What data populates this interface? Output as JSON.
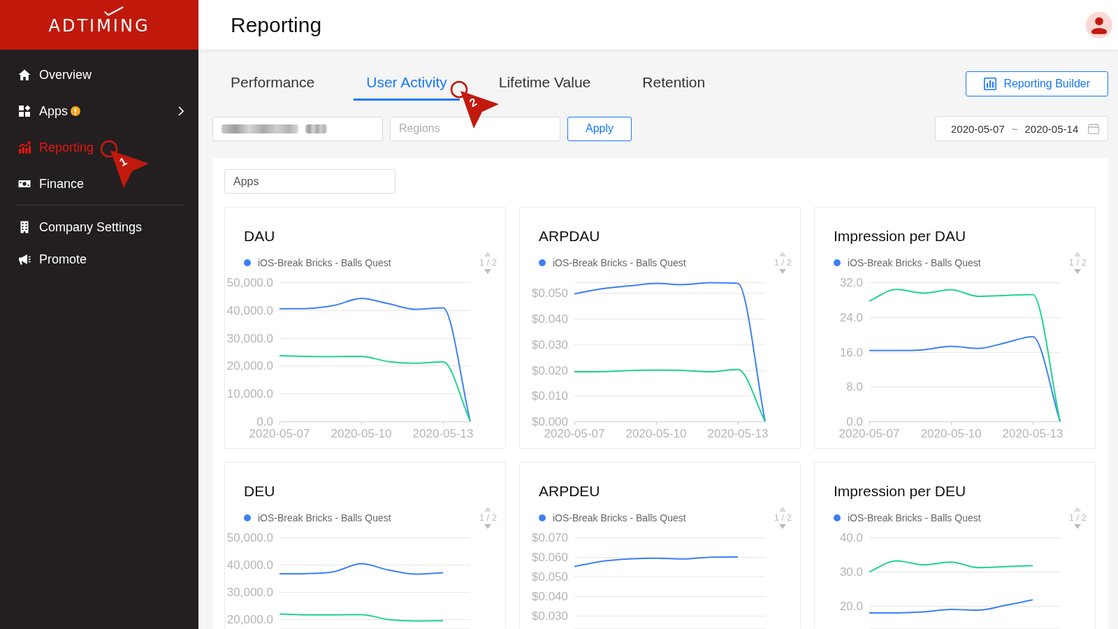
{
  "sidebar": {
    "logo": "ADTIMING",
    "groups": [
      [
        {
          "label": "Overview",
          "selected": false
        },
        {
          "label": "Apps",
          "selected": false,
          "warning": true,
          "submenu": true
        },
        {
          "label": "Reporting",
          "selected": true,
          "step_marker": "1"
        },
        {
          "label": "Finance",
          "selected": false
        }
      ],
      [
        {
          "label": "Company Settings",
          "selected": false
        },
        {
          "label": "Promote",
          "selected": false
        }
      ]
    ]
  },
  "header": {
    "title": "Reporting"
  },
  "tabs": [
    {
      "label": "Performance",
      "selected": false
    },
    {
      "label": "User Activity",
      "selected": true,
      "step_marker": "2"
    },
    {
      "label": "Lifetime Value",
      "selected": false
    },
    {
      "label": "Retention",
      "selected": false
    }
  ],
  "reporting_builder_button": "Reporting Builder",
  "filters": [
    {
      "kind": "blurred"
    },
    {
      "kind": "text",
      "placeholder": "Regions"
    }
  ],
  "apply_button": "Apply",
  "date_range": {
    "start": "2020-05-07",
    "separator": "~",
    "end": "2020-05-14"
  },
  "apps_select": {
    "value": "Apps"
  },
  "charts": [
    {
      "legend_pager": "1 / 2",
      "chart_data": {
        "type": "line",
        "title": "DAU",
        "categories": [
          "2020-05-07",
          null,
          null,
          "2020-05-10",
          null,
          null,
          "2020-05-13",
          null
        ],
        "series": [
          {
            "name": "iOS-Break Bricks - Balls Quest",
            "color": "#3d80f6",
            "values": [
              40500,
              40600,
              41700,
              44200,
              42300,
              40300,
              40800,
              0
            ]
          },
          {
            "color": "#20d38e",
            "values": [
              23600,
              23400,
              23300,
              23400,
              21500,
              20900,
              21400,
              0
            ]
          }
        ],
        "ylim": [
          0,
          50000
        ],
        "yticks": [
          {
            "value": 0,
            "label": "0.0"
          },
          {
            "value": 10000,
            "label": "10,000.0"
          },
          {
            "value": 20000,
            "label": "20,000.0"
          },
          {
            "value": 30000,
            "label": "30,000.0"
          },
          {
            "value": 40000,
            "label": "40,000.0"
          },
          {
            "value": 50000,
            "label": "50,000.0"
          }
        ],
        "grid": true
      }
    },
    {
      "legend_pager": "1 / 2",
      "chart_data": {
        "type": "line",
        "title": "ARPDAU",
        "categories": [
          "2020-05-07",
          null,
          null,
          "2020-05-10",
          null,
          null,
          "2020-05-13",
          null
        ],
        "series": [
          {
            "name": "iOS-Break Bricks - Balls Quest",
            "color": "#3d80f6",
            "values": [
              0.0497,
              0.0517,
              0.0528,
              0.0538,
              0.0533,
              0.0541,
              0.0538,
              0
            ]
          },
          {
            "color": "#20d38e",
            "values": [
              0.0193,
              0.0194,
              0.0198,
              0.02,
              0.0199,
              0.0193,
              0.0203,
              0
            ]
          }
        ],
        "ylim": [
          0,
          0.0542
        ],
        "yticks": [
          {
            "value": 0,
            "label": "$0.000"
          },
          {
            "value": 0.01,
            "label": "$0.010"
          },
          {
            "value": 0.02,
            "label": "$0.020"
          },
          {
            "value": 0.03,
            "label": "$0.030"
          },
          {
            "value": 0.04,
            "label": "$0.040"
          },
          {
            "value": 0.05,
            "label": "$0.050"
          }
        ],
        "grid": true
      }
    },
    {
      "legend_pager": "1 / 2",
      "chart_data": {
        "type": "line",
        "title": "Impression per DAU",
        "categories": [
          "2020-05-07",
          null,
          null,
          "2020-05-10",
          null,
          null,
          "2020-05-13",
          null
        ],
        "series": [
          {
            "name": "iOS-Break Bricks - Balls Quest",
            "color": "#3d80f6",
            "values": [
              16.3,
              16.3,
              16.5,
              17.3,
              16.8,
              18.1,
              19.5,
              0
            ]
          },
          {
            "color": "#20d38e",
            "values": [
              27.7,
              30.4,
              29.5,
              30.3,
              28.8,
              29.0,
              29.2,
              0
            ]
          }
        ],
        "ylim": [
          0,
          32
        ],
        "yticks": [
          {
            "value": 0,
            "label": "0.0"
          },
          {
            "value": 8,
            "label": "8.0"
          },
          {
            "value": 16,
            "label": "16.0"
          },
          {
            "value": 24,
            "label": "24.0"
          },
          {
            "value": 32,
            "label": "32.0"
          }
        ],
        "grid": true
      }
    },
    {
      "legend_pager": "1 / 2",
      "chart_data": {
        "type": "line",
        "title": "DEU",
        "categories": [
          null,
          null,
          null,
          null,
          null,
          null,
          null,
          null
        ],
        "series": [
          {
            "name": "iOS-Break Bricks - Balls Quest",
            "color": "#3d80f6",
            "values": [
              36700,
              36800,
              37500,
              40400,
              38100,
              36600,
              37100,
              null
            ]
          },
          {
            "color": "#20d38e",
            "values": [
              22000,
              21700,
              21700,
              21800,
              20000,
              19500,
              19600,
              null
            ]
          }
        ],
        "ylim": [
          16800,
          50000
        ],
        "yticks": [
          {
            "value": 20000,
            "label": "20,000.0"
          },
          {
            "value": 30000,
            "label": "30,000.0"
          },
          {
            "value": 40000,
            "label": "40,000.0"
          },
          {
            "value": 50000,
            "label": "50,000.0"
          }
        ],
        "grid": true
      }
    },
    {
      "legend_pager": "1 / 2",
      "chart_data": {
        "type": "line",
        "title": "ARPDEU",
        "categories": [
          null,
          null,
          null,
          null,
          null,
          null,
          null,
          null
        ],
        "series": [
          {
            "name": "iOS-Break Bricks - Balls Quest",
            "color": "#3d80f6",
            "values": [
              0.0551,
              0.0578,
              0.059,
              0.0594,
              0.059,
              0.0599,
              0.06,
              null
            ]
          }
        ],
        "ylim": [
          0.0236,
          0.07
        ],
        "yticks": [
          {
            "value": 0.03,
            "label": "$0.030"
          },
          {
            "value": 0.04,
            "label": "$0.040"
          },
          {
            "value": 0.05,
            "label": "$0.050"
          },
          {
            "value": 0.06,
            "label": "$0.060"
          },
          {
            "value": 0.07,
            "label": "$0.070"
          }
        ],
        "grid": true
      }
    },
    {
      "legend_pager": "1 / 2",
      "chart_data": {
        "type": "line",
        "title": "Impression per DEU",
        "categories": [
          null,
          null,
          null,
          null,
          null,
          null,
          null,
          null
        ],
        "series": [
          {
            "name": "iOS-Break Bricks - Balls Quest",
            "color": "#3d80f6",
            "values": [
              18.0,
              18.0,
              18.3,
              19.0,
              18.8,
              20.2,
              21.8,
              null
            ]
          },
          {
            "color": "#20d38e",
            "values": [
              30.0,
              33.2,
              32.0,
              32.8,
              31.2,
              31.5,
              31.8,
              null
            ]
          }
        ],
        "ylim": [
          13.5,
          40
        ],
        "yticks": [
          {
            "value": 20,
            "label": "20.0"
          },
          {
            "value": 30,
            "label": "30.0"
          },
          {
            "value": 40,
            "label": "40.0"
          }
        ],
        "grid": true
      }
    }
  ]
}
